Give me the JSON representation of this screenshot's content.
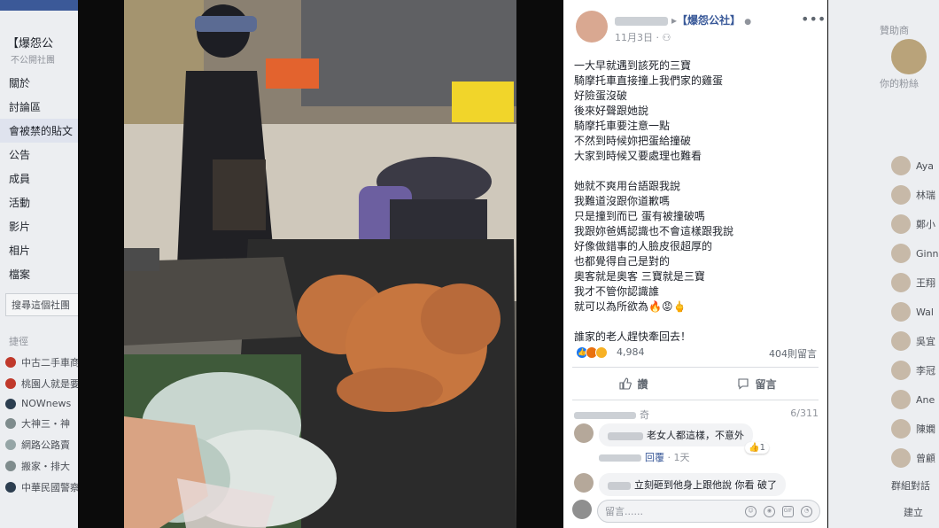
{
  "left_sidebar": {
    "group_title": "【爆怨公",
    "group_sub": "不公開社團",
    "nav": [
      "關於",
      "討論區",
      "會被禁的貼文",
      "公告",
      "成員",
      "活動",
      "影片",
      "相片",
      "檔案"
    ],
    "search_button": "搜尋這個社團",
    "section_label": "捷徑",
    "shortcuts": [
      "中古二手車商",
      "桃園人就是要",
      "NOWnews",
      "大神三・神",
      "網路公路賣",
      "搬家・排大",
      "中華民國警察"
    ]
  },
  "right_sidebar": {
    "header": "贊助商",
    "header2": "你的粉絲",
    "contacts": [
      "Aya",
      "林瑞",
      "鄭小",
      "Ginn",
      "王翔",
      "Wal",
      "吳宜",
      "李冠",
      "Ane",
      "陳嫻",
      "曾顧"
    ],
    "footer": [
      "群組對話",
      "建立"
    ]
  },
  "post": {
    "author": "【爆怨公社】",
    "date": "11月3日",
    "more_icon": "ellipsis-icon",
    "body": "一大早就遇到該死的三寶\n騎摩托車直接撞上我們家的雞蛋\n好險蛋沒破\n後來好聲跟她說\n騎摩托車要注意一點\n不然到時候妳把蛋給撞破\n大家到時候又要處理也難看\n\n她就不爽用台語跟我說\n我難道沒跟你道歉嗎\n只是撞到而已 蛋有被撞破嗎\n我跟妳爸媽認識也不會這樣跟我說\n好像做錯事的人臉皮很超厚的\n也都覺得自己是對的\n奧客就是奧客 三寶就是三寶\n我才不管你認識誰\n就可以為所欲為🔥😡🖕\n\n誰家的老人趕快牽回去！",
    "reactions": {
      "count": "4,984",
      "colors": [
        "#1877f2",
        "#f7b125",
        "#e9710f"
      ]
    },
    "comment_count": "404則留言",
    "actions": {
      "like": "讚",
      "comment": "留言"
    }
  },
  "comments": {
    "header_name": "奇",
    "pages": "6/311",
    "items": [
      {
        "text": "老女人都這樣，不意外",
        "likes": "1"
      },
      {
        "text": "立刻砸到他身上跟他說 你看  破了"
      }
    ],
    "meta_reply": "回覆",
    "meta_time": "1天",
    "composer_placeholder": "留言......"
  }
}
